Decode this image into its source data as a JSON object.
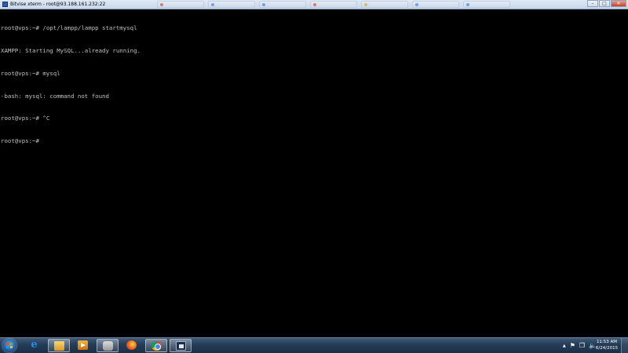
{
  "window": {
    "title": "Bitvise xterm - root@93.188.161.232:22",
    "controls": {
      "minimize_glyph": "–",
      "maximize_glyph": "□",
      "close_glyph": "✕"
    }
  },
  "terminal": {
    "lines": [
      "root@vps:~# /opt/lampp/lampp startmysql",
      "XAMPP: Starting MySQL...already running.",
      "root@vps:~# mysql",
      "-bash: mysql: command not found",
      "root@vps:~# ^C",
      "root@vps:~#"
    ],
    "foreground_color": "#c0c0c0",
    "background_color": "#000000"
  },
  "taskbar": {
    "pinned": [
      {
        "name": "internet-explorer-icon"
      },
      {
        "name": "windows-explorer-icon"
      },
      {
        "name": "media-player-icon"
      },
      {
        "name": "chat-app-icon"
      },
      {
        "name": "firefox-icon"
      },
      {
        "name": "chrome-icon"
      },
      {
        "name": "bitvise-icon"
      }
    ],
    "tray": {
      "show_hidden_glyph": "▲",
      "flag_glyph": "⚑",
      "network_glyph": "❐",
      "volume_glyph": "🔈"
    },
    "clock": {
      "time": "11:53 AM",
      "date": "6/24/2015"
    }
  }
}
